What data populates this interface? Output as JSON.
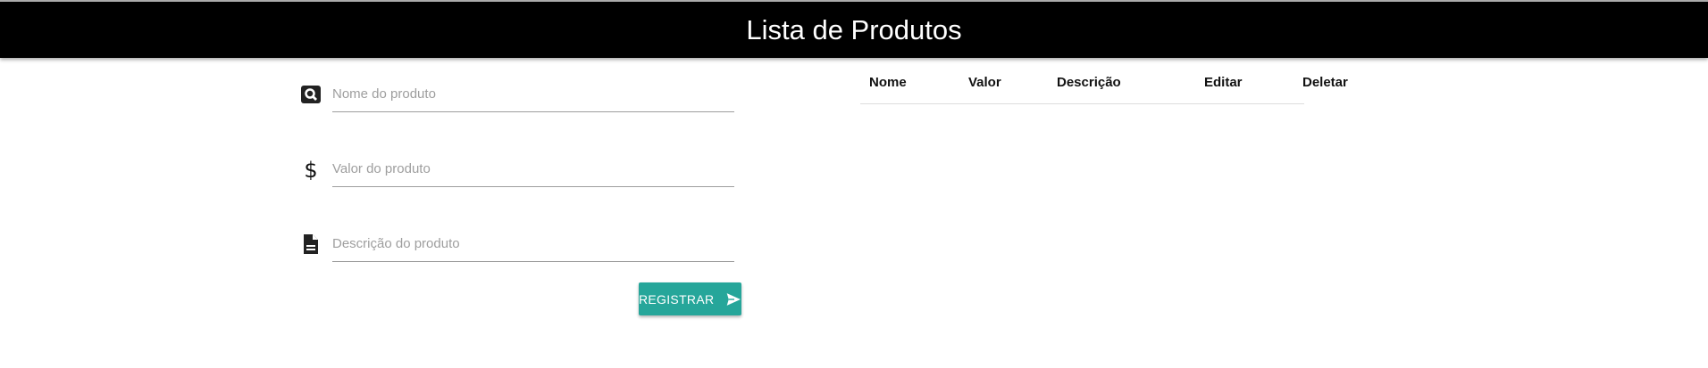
{
  "header": {
    "title": "Lista de Produtos"
  },
  "form": {
    "name_placeholder": "Nome do produto",
    "value_placeholder": "Valor do produto",
    "description_placeholder": "Descrição do produto",
    "submit_label": "REGISTRAR"
  },
  "table": {
    "columns": [
      "Nome",
      "Valor",
      "Descrição",
      "Editar",
      "Deletar"
    ]
  },
  "colors": {
    "accent": "#26a69a",
    "header_bg": "#000000"
  }
}
